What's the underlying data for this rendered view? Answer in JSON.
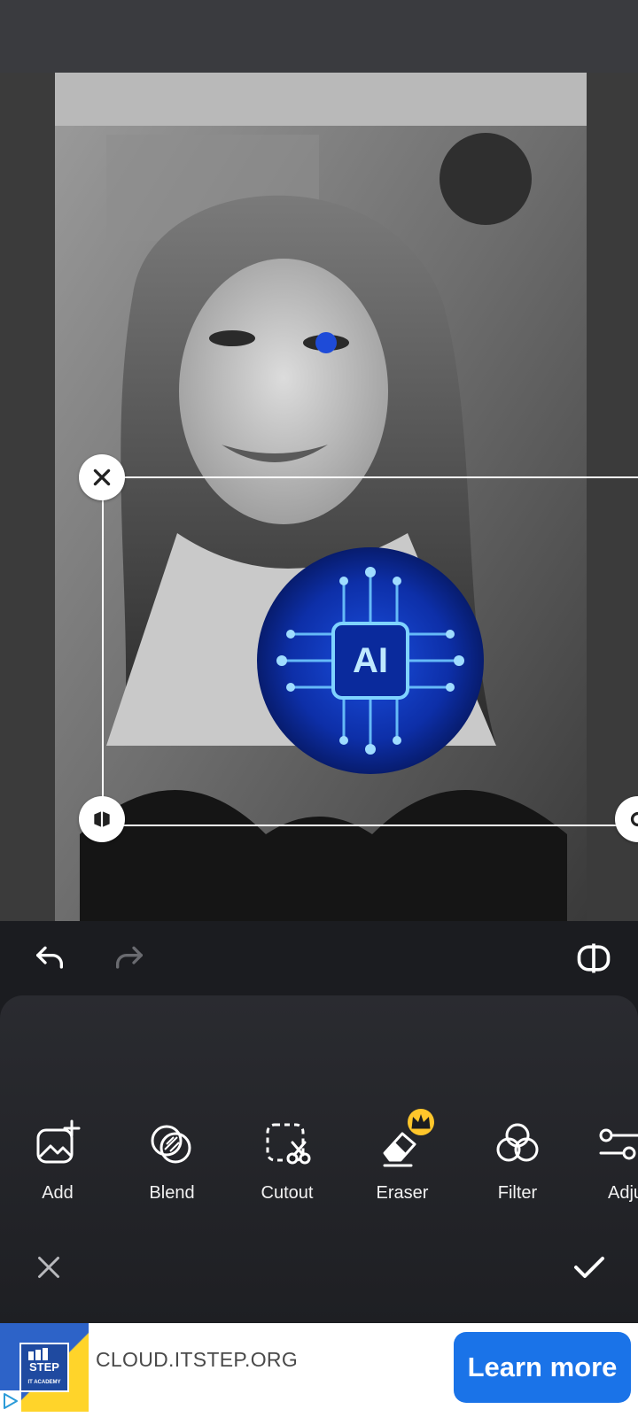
{
  "history": {
    "undo_icon": "undo-icon",
    "redo_icon": "redo-icon",
    "compare_icon": "compare-icon"
  },
  "canvas": {
    "sticker_text": "AI",
    "handles": {
      "close_icon": "close-icon",
      "flip_icon": "flip-icon",
      "rotate_icon": "rotate-icon"
    }
  },
  "tools": [
    {
      "label": "Add",
      "icon": "add-image-icon"
    },
    {
      "label": "Blend",
      "icon": "blend-icon"
    },
    {
      "label": "Cutout",
      "icon": "cutout-icon"
    },
    {
      "label": "Eraser",
      "icon": "eraser-icon",
      "premium": true
    },
    {
      "label": "Filter",
      "icon": "filter-icon"
    },
    {
      "label": "Adju",
      "icon": "adjust-icon"
    }
  ],
  "panel": {
    "cancel_icon": "cancel-icon",
    "confirm_icon": "confirm-icon"
  },
  "ad": {
    "logo_text_top": "STEP",
    "logo_text_bottom": "IT ACADEMY",
    "url": "CLOUD.ITSTEP.ORG",
    "button": "Learn more"
  },
  "colors": {
    "accent": "#1a73e8",
    "premium": "#ffc62b",
    "background": "#1b1c20"
  }
}
